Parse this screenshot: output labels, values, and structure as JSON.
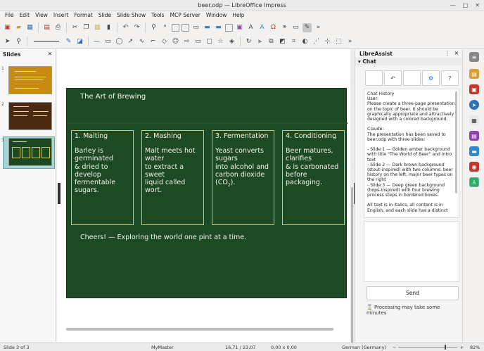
{
  "window": {
    "title": "beer.odp — LibreOffice Impress",
    "min": "—",
    "max": "□",
    "close": "✕"
  },
  "menu": [
    "File",
    "Edit",
    "View",
    "Insert",
    "Format",
    "Slide",
    "Slide Show",
    "Tools",
    "MCP Server",
    "Window",
    "Help"
  ],
  "slides_pane": {
    "title": "Slides",
    "close": "✕",
    "thumbs": [
      {
        "num": "1",
        "color": "#c98a14"
      },
      {
        "num": "2",
        "color": "#4a2a10"
      },
      {
        "num": "3",
        "color": "#1b4a22"
      }
    ]
  },
  "slide": {
    "title": "The Art of Brewing",
    "steps": [
      {
        "head": "1. Malting",
        "body": "Barley is\ngerminated\n& dried to\ndevelop\nfermentable\nsugars."
      },
      {
        "head": "2. Mashing",
        "body": "Malt meets hot\nwater\nto extract a sweet\nliquid called wort."
      },
      {
        "head": "3. Fermentation",
        "body_pre": "Yeast converts\nsugars\ninto alcohol and\ncarbon dioxide\n(CO",
        "sub": "2",
        "body_post": ")."
      },
      {
        "head": "4. Conditioning",
        "body": "Beer matures,\nclarifies\n& is carbonated\nbefore packaging."
      }
    ],
    "footer": "Cheers! — Exploring the world one pint at a time.",
    "bg": "#1d4a25",
    "box_border": "#d9c34a"
  },
  "assist": {
    "title": "LibreAssist",
    "section": "Chat",
    "buttons": [
      "",
      "↶",
      "",
      "⚙",
      "?"
    ],
    "history_text": "Chat History\nUser:\nPlease create a three-page presentation on the topic of beer. It should be graphically appropriate and attractively designed with a colored background.\n\nClaude:\nThe presentation has been saved to beer.odp with three slides:\n\n- Slide 1 — Golden amber background with title \"The World of Beer\" and intro text\n- Slide 2 — Dark brown background (stout-inspired) with two columns: beer history on the left, major beer types on the right\n- Slide 3 — Deep green background (hops-inspired) with four brewing process steps in bordered boxes\n\nAll text is in italics, all content is in English, and each slide has a distinct",
    "send_label": "Send",
    "note": "Processing may take some minutes",
    "hourglass": "⌛"
  },
  "statusbar": {
    "slide": "Slide 3 of 3",
    "master": "MyMaster",
    "position": "16,71 / 23,07",
    "size": "0,00 x 0,00",
    "language": "German (Germany)",
    "zoom": "82%",
    "minus": "−",
    "plus": "+"
  }
}
